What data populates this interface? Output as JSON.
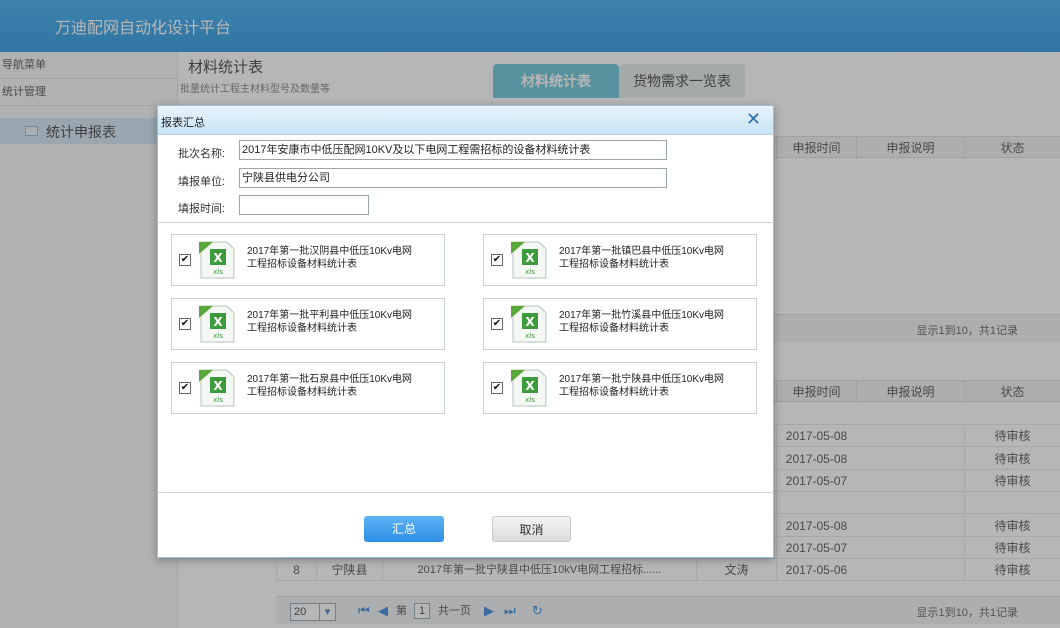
{
  "app": {
    "title": "万迪配网自动化设计平台"
  },
  "leftnav": {
    "menu_header": "导航菜单",
    "section": "统计管理",
    "active_item": "统计申报表"
  },
  "main": {
    "title": "材料统计表",
    "subtitle": "批量统计工程主材料型号及数量等",
    "tabs": [
      "材料统计表",
      "货物需求一览表"
    ],
    "table1": {
      "headers": [
        "申报时间",
        "申报说明",
        "状态"
      ],
      "pager_info": "显示1到10，共1记录"
    },
    "table2": {
      "headers": [
        "申报时间",
        "申报说明",
        "状态"
      ],
      "rows": [
        {
          "date": "2017-05-08",
          "status": "待审核"
        },
        {
          "date": "2017-05-08",
          "status": "待审核"
        },
        {
          "date": "2017-05-07",
          "status": "待审核"
        },
        {
          "date": "",
          "status": ""
        },
        {
          "date": "2017-05-08",
          "status": "待审核"
        },
        {
          "date": "2017-05-07",
          "status": "待审核"
        }
      ],
      "last_row": {
        "index": "8",
        "county": "宁陕县",
        "name": "2017年第一批宁陕县中低压10kV电网工程招标......",
        "person": "文涛",
        "date": "2017-05-06",
        "status": "待审核"
      },
      "pager": {
        "page_size": "20",
        "page_label": "第",
        "page_value": "1",
        "total_label": "共一页",
        "info": "显示1到10，共1记录"
      }
    }
  },
  "dialog": {
    "title": "报表汇总",
    "batch_label": "批次名称:",
    "batch_value": "2017年安康市中低压配网10KV及以下电网工程需招标的设备材料统计表",
    "unit_label": "填报单位:",
    "unit_value": "宁陕县供电分公司",
    "time_label": "填报时间:",
    "time_value": "",
    "files": [
      {
        "line1": "2017年第一批汉阴县中低压10Kv电网",
        "line2": "工程招标设备材料统计表",
        "checked": true
      },
      {
        "line1": "2017年第一批镇巴县中低压10Kv电网",
        "line2": "工程招标设备材料统计表",
        "checked": true
      },
      {
        "line1": "2017年第一批平利县中低压10Kv电网",
        "line2": "工程招标设备材料统计表",
        "checked": true
      },
      {
        "line1": "2017年第一批竹溪县中低压10Kv电网",
        "line2": "工程招标设备材料统计表",
        "checked": true
      },
      {
        "line1": "2017年第一批石泉县中低压10Kv电网",
        "line2": "工程招标设备材料统计表",
        "checked": true
      },
      {
        "line1": "2017年第一批宁陕县中低压10Kv电网",
        "line2": "工程招标设备材料统计表",
        "checked": true
      }
    ],
    "file_icon_label": "xls",
    "submit_label": "汇总",
    "cancel_label": "取消",
    "close_glyph": "✕"
  }
}
